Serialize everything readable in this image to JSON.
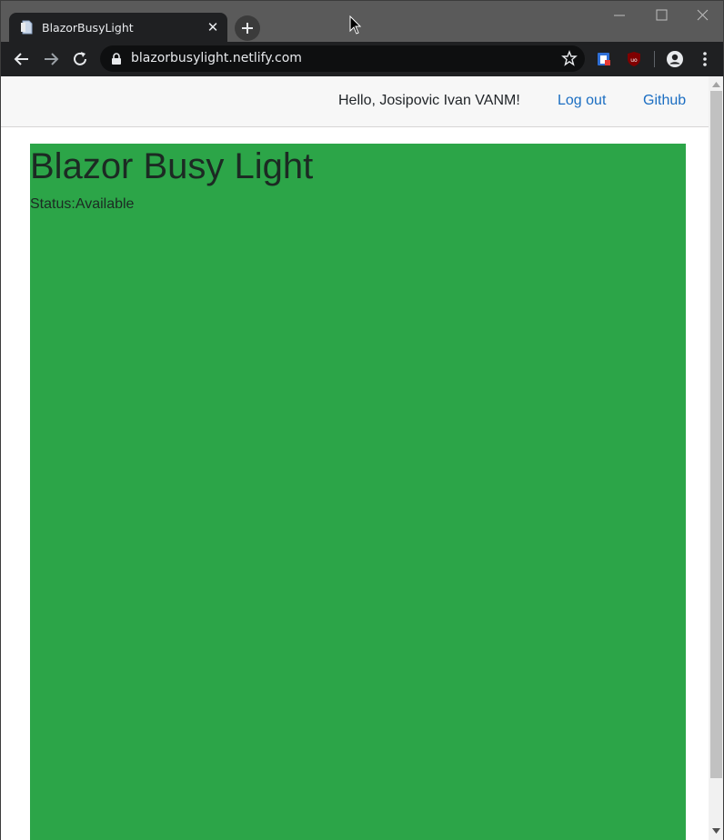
{
  "browser": {
    "tab": {
      "title": "BlazorBusyLight",
      "close_glyph": "✕"
    },
    "address_bar": {
      "url": "blazorbusylight.netlify.com"
    },
    "icons": [
      "page-icon",
      "close-icon",
      "plus-icon",
      "back-arrow-icon",
      "forward-arrow-icon",
      "reload-icon",
      "lock-icon",
      "star-icon",
      "extension-icon",
      "ublock-icon",
      "profile-icon",
      "more-vert-icon",
      "minimize-icon",
      "maximize-icon",
      "window-close-icon",
      "mouse-cursor-icon"
    ]
  },
  "header": {
    "greeting": "Hello, Josipovic Ivan VANM!",
    "logout_label": "Log out",
    "github_label": "Github"
  },
  "busy_light": {
    "title": "Blazor Busy Light",
    "status_label": "Status:",
    "status_value": "Available",
    "color": "#2ca548"
  },
  "colors": {
    "link": "#1b6ec2",
    "header_bg": "#f7f7f7",
    "chrome_dark": "#1f2022",
    "titlebar": "#5a5a5a"
  }
}
